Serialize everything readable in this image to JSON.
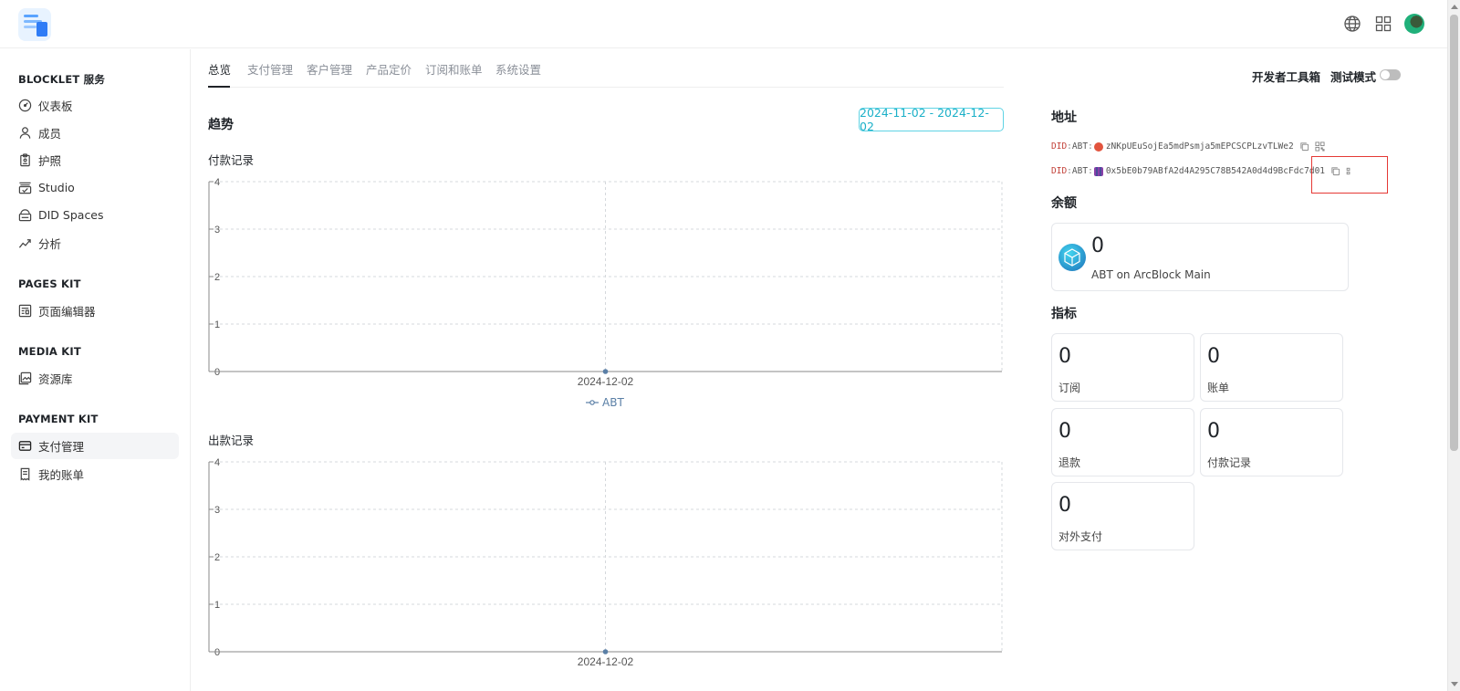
{
  "sidebar": {
    "sections": [
      {
        "title": "BLOCKLET 服务",
        "items": [
          {
            "label": "仪表板",
            "icon": "dashboard-icon"
          },
          {
            "label": "成员",
            "icon": "user-icon"
          },
          {
            "label": "护照",
            "icon": "passport-icon"
          },
          {
            "label": "Studio",
            "icon": "studio-icon"
          },
          {
            "label": "DID Spaces",
            "icon": "did-spaces-icon"
          },
          {
            "label": "分析",
            "icon": "analytics-icon"
          }
        ]
      },
      {
        "title": "PAGES KIT",
        "items": [
          {
            "label": "页面编辑器",
            "icon": "page-editor-icon"
          }
        ]
      },
      {
        "title": "MEDIA KIT",
        "items": [
          {
            "label": "资源库",
            "icon": "media-library-icon"
          }
        ]
      },
      {
        "title": "PAYMENT KIT",
        "items": [
          {
            "label": "支付管理",
            "icon": "payment-card-icon",
            "active": true
          },
          {
            "label": "我的账单",
            "icon": "invoice-icon"
          }
        ]
      }
    ]
  },
  "tabs": [
    "总览",
    "支付管理",
    "客户管理",
    "产品定价",
    "订阅和账单",
    "系统设置"
  ],
  "header": {
    "dev_tools": "开发者工具箱",
    "test_mode": "测试模式",
    "test_mode_on": false
  },
  "trend": {
    "title": "趋势",
    "date_range": "2024-11-02 - 2024-12-02",
    "legend": "ABT"
  },
  "chart_data": [
    {
      "type": "line",
      "title": "付款记录",
      "x": [
        "2024-12-02"
      ],
      "series": [
        {
          "name": "ABT",
          "values": [
            0
          ]
        }
      ],
      "ylim": [
        0,
        4
      ],
      "yticks": [
        "0",
        "1",
        "2",
        "3",
        "4"
      ],
      "grid": true,
      "legend": "bottom-center"
    },
    {
      "type": "line",
      "title": "出款记录",
      "x": [
        "2024-12-02"
      ],
      "series": [
        {
          "values": [
            0
          ]
        }
      ],
      "ylim": [
        0,
        4
      ],
      "yticks": [
        "0",
        "1",
        "2",
        "3",
        "4"
      ],
      "grid": true
    }
  ],
  "address": {
    "title": "地址",
    "rows": [
      {
        "prefix": "DID",
        "chain": "ABT",
        "value": "zNKpUEuSojEa5mdPsmja5mEPCSCPLzvTLWe2",
        "avatar_color": "#e2543e"
      },
      {
        "prefix": "DID",
        "chain": "ABT",
        "value": "0x5bE0b79ABfA2d4A295C78B542A0d4d9BcFdc7d01",
        "avatar_color": "#8a3fa8"
      }
    ]
  },
  "balance": {
    "title": "余额",
    "value": "0",
    "network": "ABT on ArcBlock Main"
  },
  "metrics": {
    "title": "指标",
    "items": [
      {
        "value": "0",
        "label": "订阅"
      },
      {
        "value": "0",
        "label": "账单"
      },
      {
        "value": "0",
        "label": "退款"
      },
      {
        "value": "0",
        "label": "付款记录"
      },
      {
        "value": "0",
        "label": "对外支付"
      }
    ]
  },
  "colors": {
    "accent": "#1bb0c8",
    "highlight": "#e53935",
    "line": "#5a7fa6"
  }
}
